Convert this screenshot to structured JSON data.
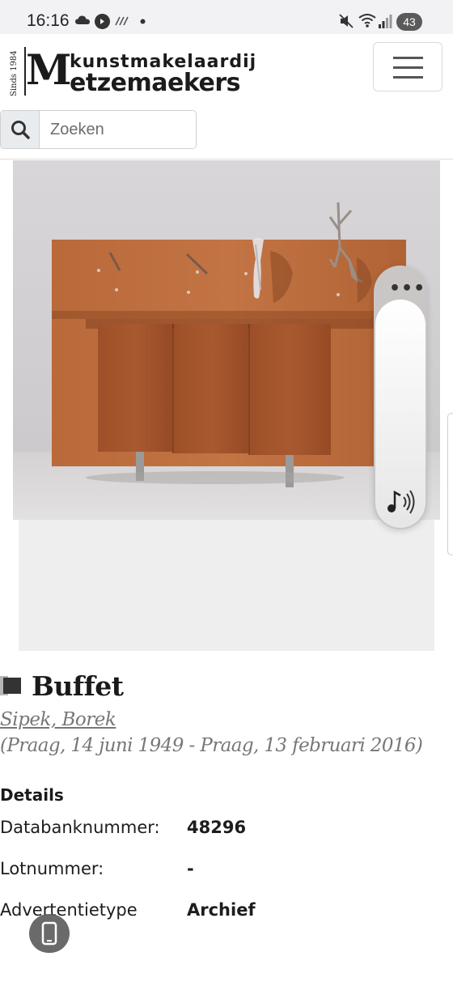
{
  "status_bar": {
    "time": "16:16",
    "battery": "43",
    "icons": [
      "cloud-icon",
      "music-app-icon",
      "call-stats-icon",
      "dot-icon",
      "mute-icon",
      "wifi-icon",
      "signal-icon",
      "battery-icon"
    ]
  },
  "header": {
    "logo_since": "Sinds 1984",
    "logo_top": "kunstmakelaardij",
    "logo_initial": "M",
    "logo_rest": "etzemaekers",
    "menu_icon": "hamburger-icon",
    "search": {
      "placeholder": "Zoeken",
      "value": "",
      "icon": "search-icon"
    }
  },
  "product": {
    "image_subject": "Buffet",
    "title": "Buffet",
    "artist": "Sipek, Borek",
    "artist_dates": "(Praag, 14 juni 1949 - Praag, 13 februari 2016)"
  },
  "details": {
    "heading": "Details",
    "rows": [
      {
        "label": "Databanknummer:",
        "value": "48296"
      },
      {
        "label": "Lotnummer:",
        "value": "-"
      },
      {
        "label": "Advertentietype",
        "value": "Archief"
      }
    ]
  },
  "overlay": {
    "more_icon": "more-dots-icon",
    "sound_icon": "sound-wave-icon",
    "phone_icon": "phone-icon"
  },
  "colors": {
    "status_bar_bg": "#f2f2f4",
    "search_addon_bg": "#e9ecef",
    "artist_text": "#777777",
    "wood": "#b56a3b"
  }
}
